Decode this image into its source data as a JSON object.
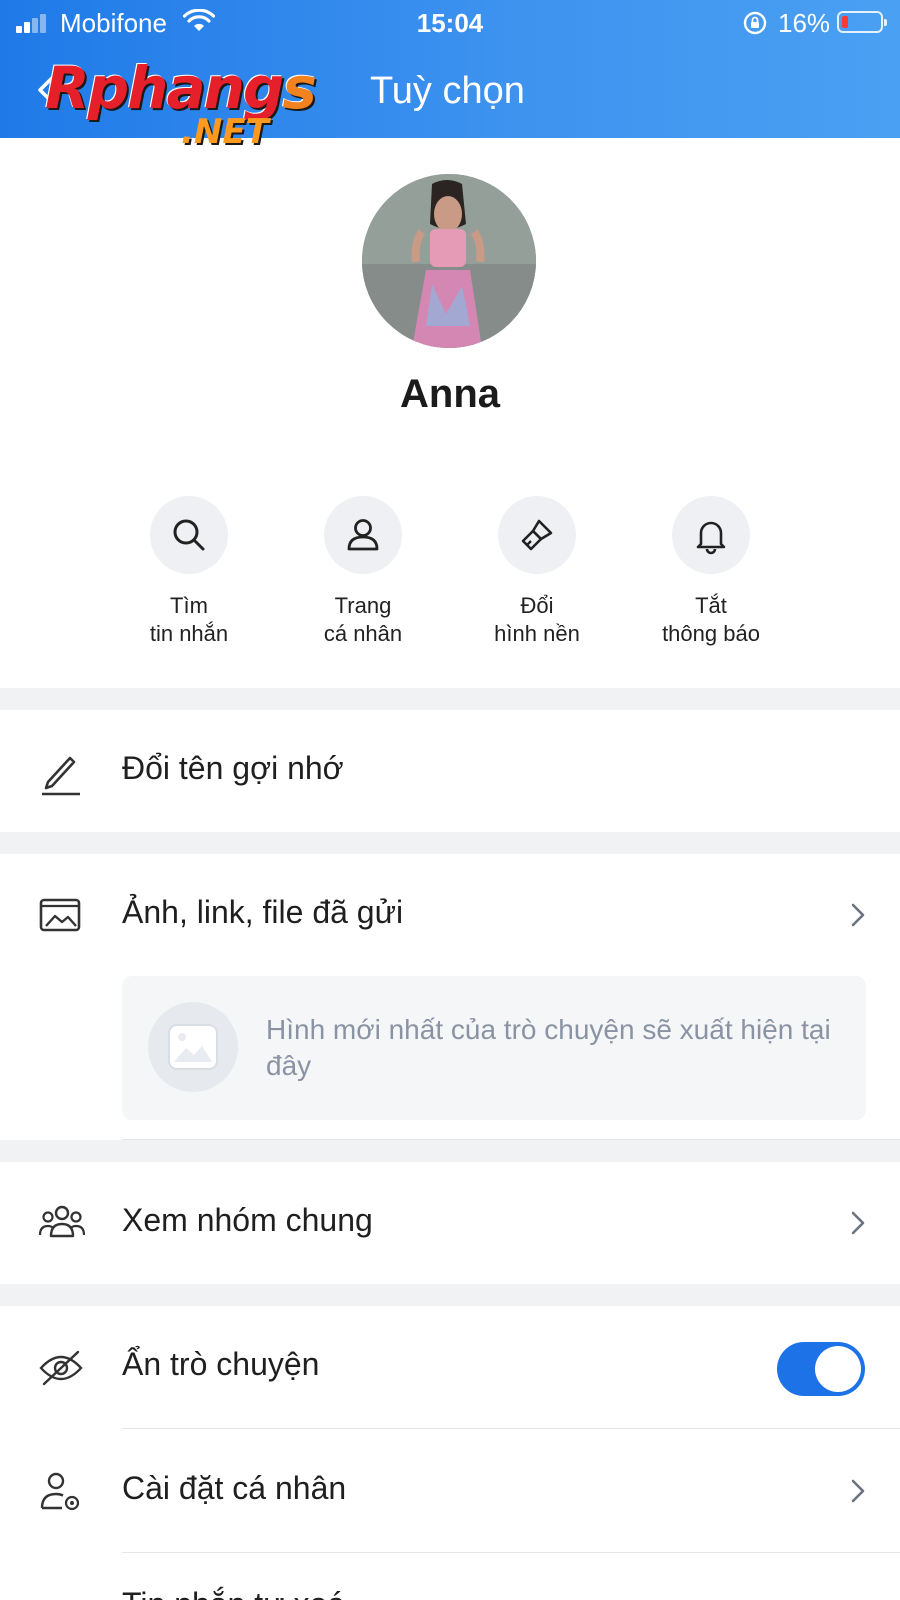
{
  "status_bar": {
    "carrier": "Mobifone",
    "time": "15:04",
    "battery_percent": "16%",
    "battery_level": 0.16,
    "signal_bars": 2
  },
  "header": {
    "title": "Tuỳ chọn",
    "back_icon": "chevron-left-icon",
    "watermark_line1": "Rphangs",
    "watermark_line2": ".NET"
  },
  "profile": {
    "name": "Anna"
  },
  "quick_actions": [
    {
      "icon": "search-icon",
      "line1": "Tìm",
      "line2": "tin nhắn"
    },
    {
      "icon": "user-icon",
      "line1": "Trang",
      "line2": "cá nhân"
    },
    {
      "icon": "paint-brush-icon",
      "line1": "Đổi",
      "line2": "hình nền"
    },
    {
      "icon": "bell-icon",
      "line1": "Tắt",
      "line2": "thông báo"
    }
  ],
  "menu": {
    "rename": "Đổi tên gợi nhớ",
    "media": "Ảnh, link, file đã gửi",
    "media_empty": "Hình mới nhất của trò chuyện sẽ xuất hiện tại đây",
    "groups": "Xem nhóm chung",
    "hide_chat": "Ẩn trò chuyện",
    "hide_chat_on": true,
    "personal_settings": "Cài đặt cá nhân",
    "next_item_partial": "Tin nhắn tự xoá"
  },
  "colors": {
    "header_start": "#1f7ae8",
    "header_end": "#4aa0f2",
    "toggle_on": "#1d72e8",
    "separator": "#f1f2f4"
  }
}
